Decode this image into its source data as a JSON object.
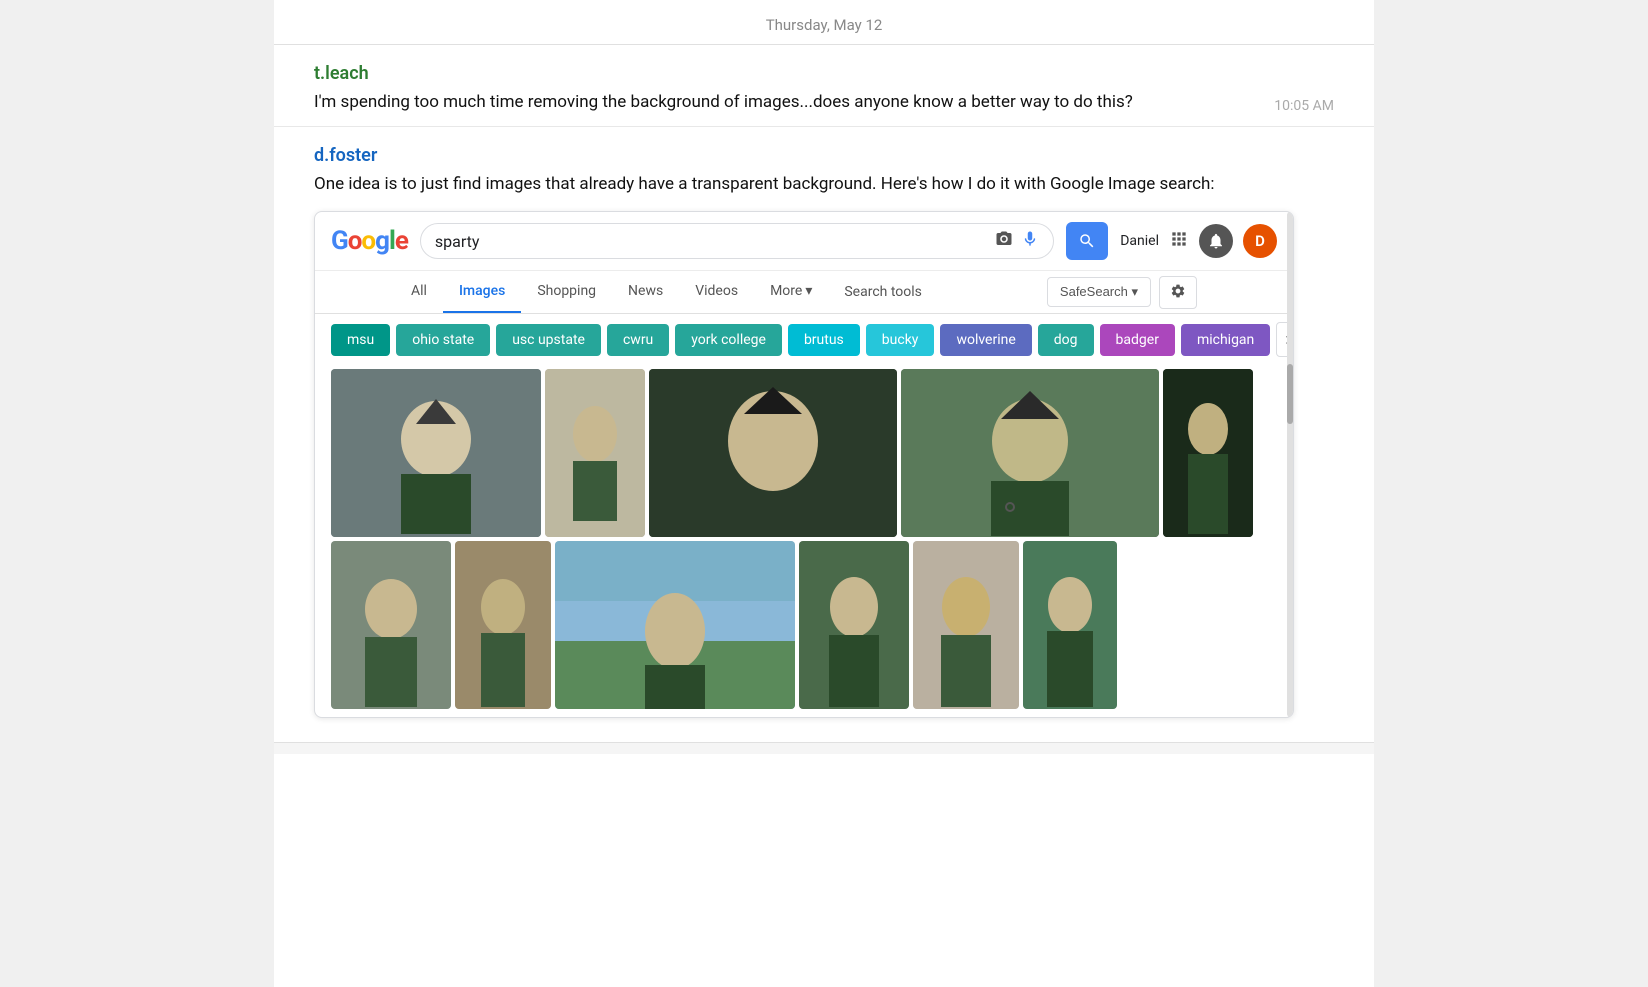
{
  "header": {
    "date": "Thursday, May 12"
  },
  "messages": {
    "first": {
      "username": "t.leach",
      "text": "I'm spending too much time removing the background of images...does anyone know a better way to do this?",
      "timestamp": "10:05 AM"
    },
    "second": {
      "username": "d.foster",
      "intro": "One idea is to just find images that already have a transparent background. Here's how I do it with Google Image search:"
    }
  },
  "google": {
    "logo_letters": [
      "G",
      "o",
      "o",
      "g",
      "l",
      "e"
    ],
    "search_query": "sparty",
    "header_name": "Daniel",
    "header_avatar": "D",
    "nav_tabs": [
      {
        "label": "All",
        "active": false
      },
      {
        "label": "Images",
        "active": true
      },
      {
        "label": "Shopping",
        "active": false
      },
      {
        "label": "News",
        "active": false
      },
      {
        "label": "Videos",
        "active": false
      },
      {
        "label": "More",
        "active": false,
        "has_arrow": true
      },
      {
        "label": "Search tools",
        "active": false
      }
    ],
    "safe_search": "SafeSearch",
    "chips": [
      {
        "label": "msu",
        "color_class": "chip-msu"
      },
      {
        "label": "ohio state",
        "color_class": "chip-ohio"
      },
      {
        "label": "usc upstate",
        "color_class": "chip-usc"
      },
      {
        "label": "cwru",
        "color_class": "chip-cwru"
      },
      {
        "label": "york college",
        "color_class": "chip-york"
      },
      {
        "label": "brutus",
        "color_class": "chip-brutus"
      },
      {
        "label": "bucky",
        "color_class": "chip-bucky"
      },
      {
        "label": "wolverine",
        "color_class": "chip-wolverine"
      },
      {
        "label": "dog",
        "color_class": "chip-dog"
      },
      {
        "label": "badger",
        "color_class": "chip-badger"
      },
      {
        "label": "michigan",
        "color_class": "chip-michigan"
      }
    ],
    "next_button": "›"
  }
}
